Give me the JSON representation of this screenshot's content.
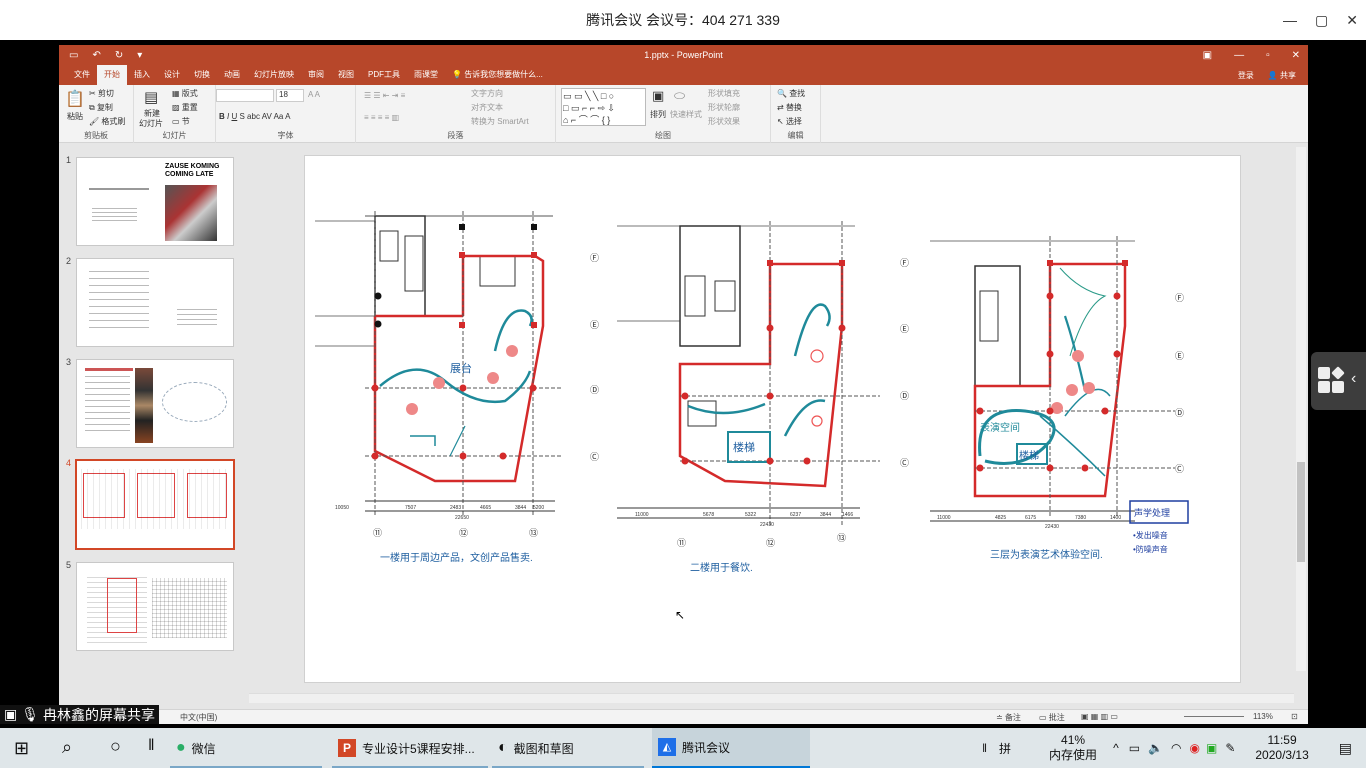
{
  "meeting": {
    "title": "腾讯会议 会议号：404 271 339",
    "controls": [
      "—",
      "▢",
      "✕"
    ]
  },
  "ppt": {
    "doc_title": "1.pptx - PowerPoint",
    "window_controls": [
      "▣",
      "—",
      "▫",
      "✕"
    ],
    "tabs": [
      "文件",
      "开始",
      "插入",
      "设计",
      "切换",
      "动画",
      "幻灯片放映",
      "审阅",
      "视图",
      "PDF工具",
      "雨课堂"
    ],
    "tell_me": "告诉我您想要做什么...",
    "login": "登录",
    "share": "共享",
    "ribbon": {
      "clipboard": {
        "label": "剪贴板",
        "paste": "粘贴",
        "cut": "剪切",
        "copy": "复制",
        "format_painter": "格式刷"
      },
      "slides": {
        "label": "幻灯片",
        "new_slide": "新建",
        "new_slide2": "幻灯片",
        "layout": "版式",
        "reset": "重置",
        "section": "节"
      },
      "font": {
        "label": "字体",
        "size": "18"
      },
      "paragraph": {
        "label": "段落",
        "text_direction": "文字方向",
        "align_text": "对齐文本",
        "smartart": "转换为 SmartArt"
      },
      "drawing": {
        "label": "绘图",
        "arrange": "排列",
        "quick_styles": "快速样式",
        "shape_fill": "形状填充",
        "shape_outline": "形状轮廓",
        "shape_effects": "形状效果"
      },
      "editing": {
        "label": "编辑",
        "find": "查找",
        "replace": "替换",
        "select": "选择"
      }
    },
    "ime": {
      "logo": "S",
      "mode": "中"
    },
    "slides": [
      {
        "num": "1"
      },
      {
        "num": "2"
      },
      {
        "num": "3"
      },
      {
        "num": "4"
      },
      {
        "num": "5"
      }
    ],
    "thumb1_title": "ZAUSE KOMING COMING LATE",
    "status": {
      "language": "中文(中国)",
      "notes": "备注",
      "comments": "批注",
      "zoom": "113%"
    },
    "plans": {
      "plan1_note": "一楼用于周边产品，文创产品售卖.",
      "plan1_label": "展台",
      "plan2_note": "二楼用于餐饮.",
      "plan2_label": "楼梯",
      "plan3_note": "三层为表演艺术体验空间.",
      "plan3_label": "楼梯",
      "plan3_label2": "表演空间",
      "plan3_box": "声学处理",
      "plan3_bullets": [
        "•发出噪音",
        "•防噪声音"
      ],
      "dims1": [
        "10050",
        "7507",
        "2483",
        "4665",
        "3844",
        "5200"
      ],
      "total1": "22650",
      "dims2": [
        "11000",
        "5678",
        "5322",
        "6237",
        "3844",
        "1466"
      ],
      "total2": "22430",
      "dims3": [
        "11000",
        "4825",
        "6175",
        "7380",
        "1400"
      ],
      "total3": "22430",
      "axis_left": [
        "⑪",
        "⑫",
        "⑬"
      ],
      "row_axes": [
        "Ⓕ",
        "Ⓔ",
        "Ⓓ",
        "Ⓒ"
      ]
    }
  },
  "share_label": "冉林鑫的屏幕共享",
  "taskbar": {
    "apps": [
      {
        "label": "微信"
      },
      {
        "label": "专业设计5课程安排..."
      },
      {
        "label": "截图和草图"
      },
      {
        "label": "腾讯会议"
      }
    ],
    "ime": "拼",
    "memory_pct": "41%",
    "memory_label": "内存使用",
    "time": "11:59",
    "date": "2020/3/13"
  },
  "colors": {
    "ppt_red": "#b7472a",
    "plan_red": "#d42a2a",
    "teal": "#1f8a9a"
  }
}
